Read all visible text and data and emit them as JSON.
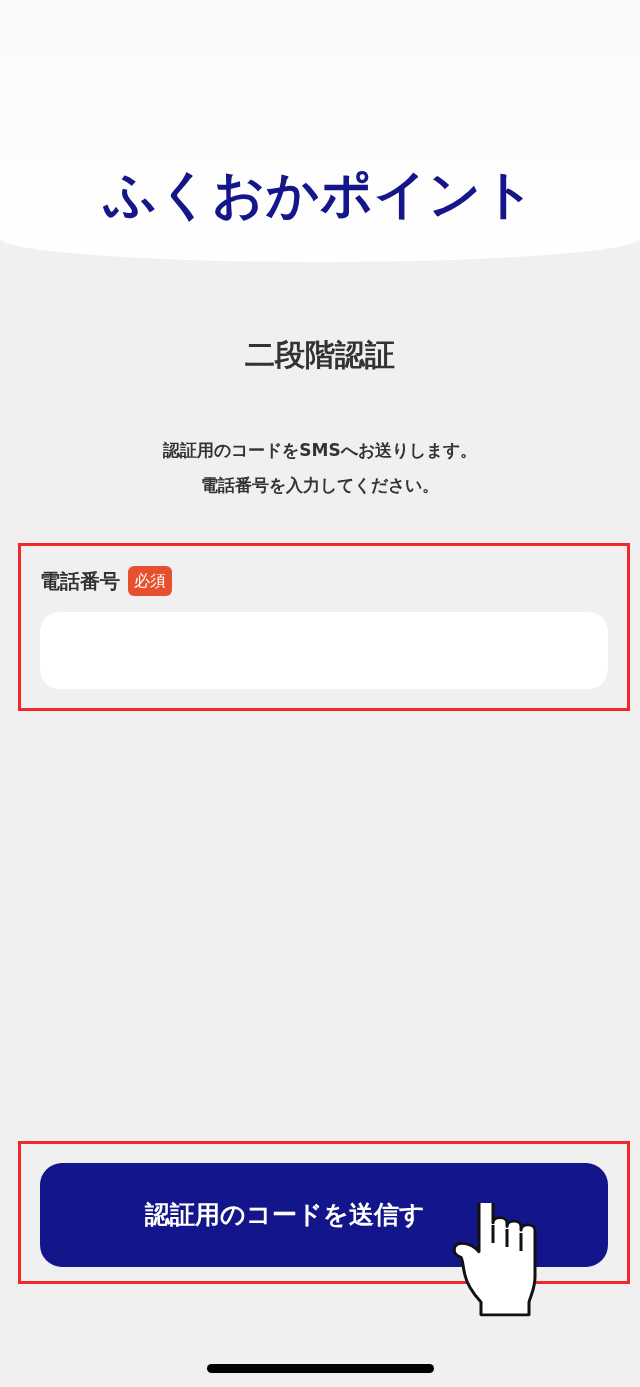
{
  "header": {
    "logo": "ふくおかポイント"
  },
  "title": "二段階認証",
  "description": [
    "認証用のコードをSMSへお送りします。",
    "電話番号を入力してください。"
  ],
  "phone_field": {
    "label": "電話番号",
    "required_badge": "必須",
    "highlighted": true
  },
  "submit_button": {
    "label": "認証用のコードを送信す",
    "highlighted": true,
    "tap_hint": true
  }
}
